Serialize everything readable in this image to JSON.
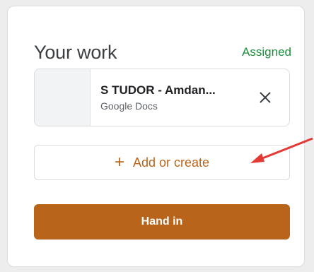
{
  "card": {
    "title": "Your work",
    "status": "Assigned"
  },
  "attachment": {
    "title": "S TUDOR - Amdan...",
    "type": "Google Docs",
    "remove_icon": "close-icon"
  },
  "add_button": {
    "icon": "plus-icon",
    "label": "Add or create"
  },
  "handin_button": {
    "label": "Hand in"
  },
  "colors": {
    "accent": "#b8651b",
    "status": "#1e8e3e",
    "arrow": "#e53935"
  }
}
